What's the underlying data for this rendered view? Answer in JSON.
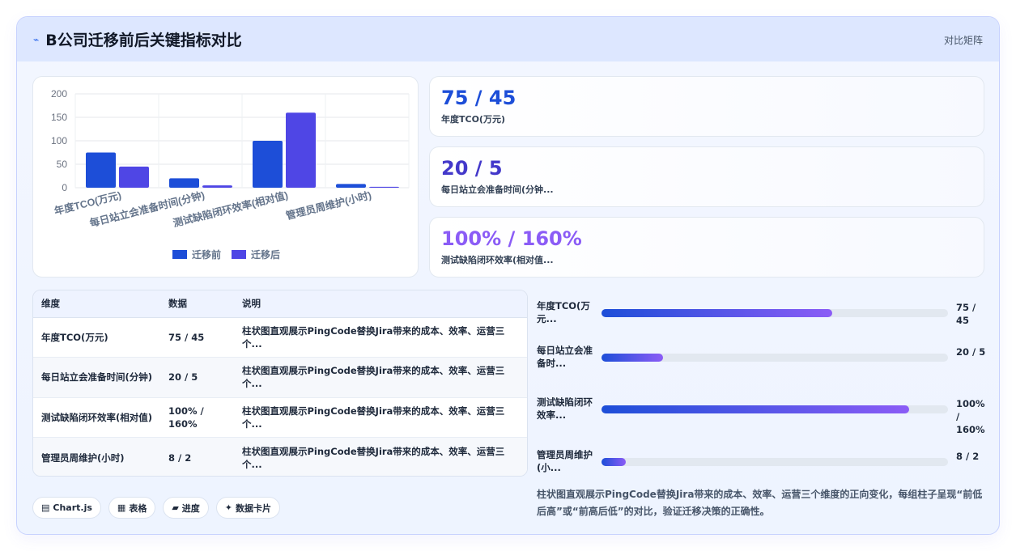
{
  "header": {
    "title": "B公司迁移前后关键指标对比",
    "tag": "对比矩阵"
  },
  "chart_data": {
    "type": "bar",
    "categories": [
      "年度TCO(万元)",
      "每日站立会准备时间(分钟)",
      "测试缺陷闭环效率(相对值)",
      "管理员周维护(小时)"
    ],
    "series": [
      {
        "name": "迁移前",
        "values": [
          75,
          20,
          100,
          8
        ],
        "color": "#1d4ed8"
      },
      {
        "name": "迁移后",
        "values": [
          45,
          5,
          160,
          2
        ],
        "color": "#4f46e5"
      }
    ],
    "ylim": [
      0,
      200
    ],
    "yticks": [
      "0",
      "50",
      "100",
      "150",
      "200"
    ],
    "grid": true,
    "legend": "bottom"
  },
  "stats": [
    {
      "value": "75 / 45",
      "label": "年度TCO(万元)",
      "color": "#1d4ed8"
    },
    {
      "value": "20 / 5",
      "label": "每日站立会准备时间(分钟...",
      "color": "#4338ca"
    },
    {
      "value": "100% / 160%",
      "label": "测试缺陷闭环效率(相对值...",
      "color": "#8b5cf6"
    }
  ],
  "table": {
    "headers": [
      "维度",
      "数据",
      "说明"
    ],
    "rows": [
      [
        "年度TCO(万元)",
        "75 / 45",
        "柱状图直观展示PingCode替换Jira带来的成本、效率、运营三个..."
      ],
      [
        "每日站立会准备时间(分钟)",
        "20 / 5",
        "柱状图直观展示PingCode替换Jira带来的成本、效率、运营三个..."
      ],
      [
        "测试缺陷闭环效率(相对值)",
        "100% / 160%",
        "柱状图直观展示PingCode替换Jira带来的成本、效率、运营三个..."
      ],
      [
        "管理员周维护(小时)",
        "8 / 2",
        "柱状图直观展示PingCode替换Jira带来的成本、效率、运营三个..."
      ]
    ]
  },
  "progress": [
    {
      "label": "年度TCO(万元...",
      "value": "75 / 45",
      "fraction": 0.667
    },
    {
      "label": "每日站立会准备时...",
      "value": "20 / 5",
      "fraction": 0.178
    },
    {
      "label": "测试缺陷闭环效率...",
      "value": "100% / 160%",
      "fraction": 0.889
    },
    {
      "label": "管理员周维护(小...",
      "value": "8 / 2",
      "fraction": 0.071
    }
  ],
  "chips": [
    {
      "icon": "chart-icon",
      "glyph": "▤",
      "label": "Chart.js"
    },
    {
      "icon": "table-icon",
      "glyph": "▦",
      "label": "表格"
    },
    {
      "icon": "progress-icon",
      "glyph": "▰",
      "label": "进度"
    },
    {
      "icon": "sparkle-icon",
      "glyph": "✦",
      "label": "数据卡片"
    }
  ],
  "summary": "柱状图直观展示PingCode替换Jira带来的成本、效率、运营三个维度的正向变化，每组柱子呈现“前低后高”或“前高后低”的对比，验证迁移决策的正确性。"
}
